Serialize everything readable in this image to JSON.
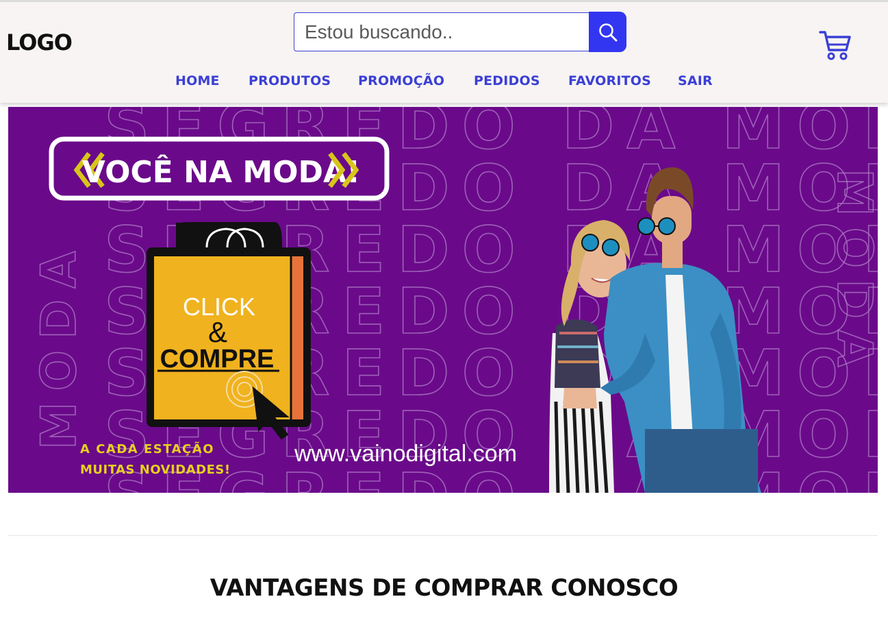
{
  "header": {
    "logo": "LOGO",
    "search": {
      "placeholder": "Estou buscando..",
      "value": ""
    },
    "nav": [
      "HOME",
      "PRODUTOS",
      "PROMOÇÃO",
      "PEDIDOS",
      "FAVORITOS",
      "SAIR"
    ]
  },
  "banner": {
    "headline": "VOCÊ NA MODA!",
    "background_text": "SEGREDO DA MODA",
    "bag_line1": "CLICK",
    "bag_line2": "&",
    "bag_line3": "COMPRE",
    "tagline_1": "A CADA ESTAÇÃO",
    "tagline_2": "MUITAS NOVIDADES!",
    "website": "www.vainodigital.com"
  },
  "section": {
    "title": "VANTAGENS DE COMPRAR CONOSCO"
  },
  "icons": {
    "search": "search-icon",
    "cart": "cart-icon"
  },
  "colors": {
    "accent": "#3336f0",
    "nav_text": "#3b3fd6",
    "banner_bg": "#6a0a8a",
    "bag_yellow": "#f0b21e",
    "bag_orange": "#e8733a",
    "chevron_yellow": "#d7c51b"
  }
}
